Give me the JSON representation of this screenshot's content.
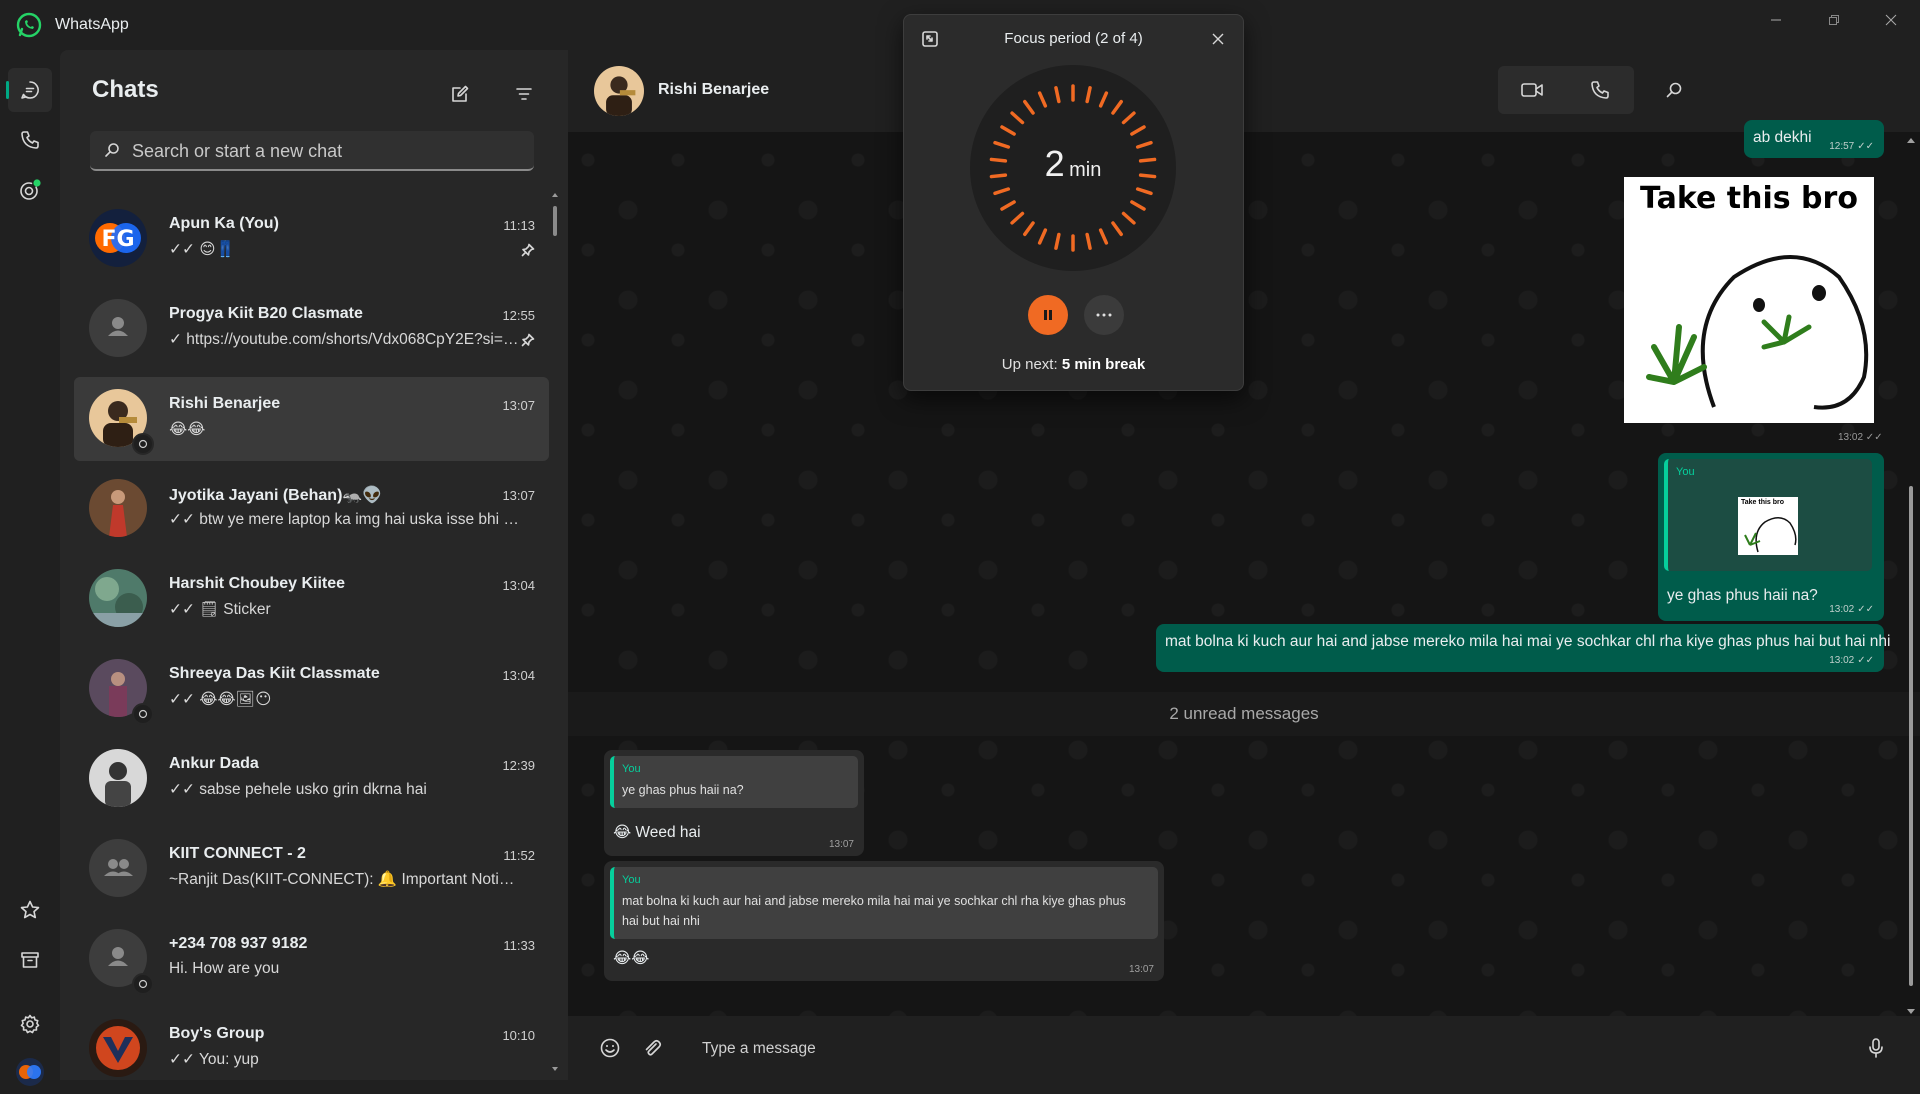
{
  "app": {
    "title": "WhatsApp"
  },
  "sidebar": {
    "title": "Chats"
  },
  "search": {
    "placeholder": "Search or start a new chat"
  },
  "chats": [
    {
      "name": "Apun Ka (You)",
      "time": "11:13",
      "preview": "✓✓ 😊👖",
      "pinned": true
    },
    {
      "name": "Progya Kiit B20 Clasmate",
      "time": "12:55",
      "preview": "✓ https://youtube.com/shorts/Vdx068CpY2E?si=X...",
      "pinned": true
    },
    {
      "name": "Rishi Benarjee",
      "time": "13:07",
      "preview": "😂😂",
      "selected": true
    },
    {
      "name": "Jyotika Jayani (Behan)🦡👽",
      "time": "13:07",
      "preview": "✓✓ btw ye mere laptop ka img hai uska isse bhi bat..."
    },
    {
      "name": "Harshit Choubey Kiitee",
      "time": "13:04",
      "preview": "✓✓ 🗒 Sticker"
    },
    {
      "name": "Shreeya Das Kiit Classmate",
      "time": "13:04",
      "preview": "✓✓ 😂😂🖼😶"
    },
    {
      "name": "Ankur Dada",
      "time": "12:39",
      "preview": "✓✓ sabse pehele usko grin dkrna hai"
    },
    {
      "name": "KIIT CONNECT - 2",
      "time": "11:52",
      "preview": "~Ranjit Das(KIIT-CONNECT): 🔔 Important Notice:..."
    },
    {
      "name": "+234 708 937 9182",
      "time": "11:33",
      "preview": "Hi. How are you"
    },
    {
      "name": "Boy's Group",
      "time": "10:10",
      "preview": "✓✓ You: yup"
    }
  ],
  "conversation": {
    "contact_name": "Rishi Benarjee",
    "messages": {
      "m1": {
        "text": "ab dekhi",
        "time": "12:57"
      },
      "sticker": {
        "text": "Take this bro",
        "time": "13:02"
      },
      "m2": {
        "quote_author": "You",
        "quote_text": "Take this bro",
        "text": "ye ghas phus haii na?",
        "time": "13:02"
      },
      "m3": {
        "text": "mat bolna ki kuch aur hai and jabse mereko mila hai mai ye sochkar chl rha kiye ghas phus hai but hai nhi",
        "time": "13:02"
      },
      "unread_divider": "2 unread messages",
      "r1": {
        "quote_author": "You",
        "quote_text": "ye ghas phus haii na?",
        "text": "😂 Weed hai",
        "time": "13:07"
      },
      "r2": {
        "quote_author": "You",
        "quote_text": "mat bolna ki kuch aur hai and jabse mereko mila hai mai ye sochkar chl rha kiye ghas phus hai but hai nhi",
        "text": "😂😂",
        "time": "13:07"
      }
    }
  },
  "composer": {
    "placeholder": "Type a message"
  },
  "focus": {
    "title": "Focus period (2 of 4)",
    "value": "2",
    "unit": "min",
    "up_next_label": "Up next:",
    "up_next_value": "5 min break"
  },
  "colors": {
    "accent": "#00a884",
    "outgoing": "#005c4b",
    "focus_orange": "#f06a23"
  }
}
